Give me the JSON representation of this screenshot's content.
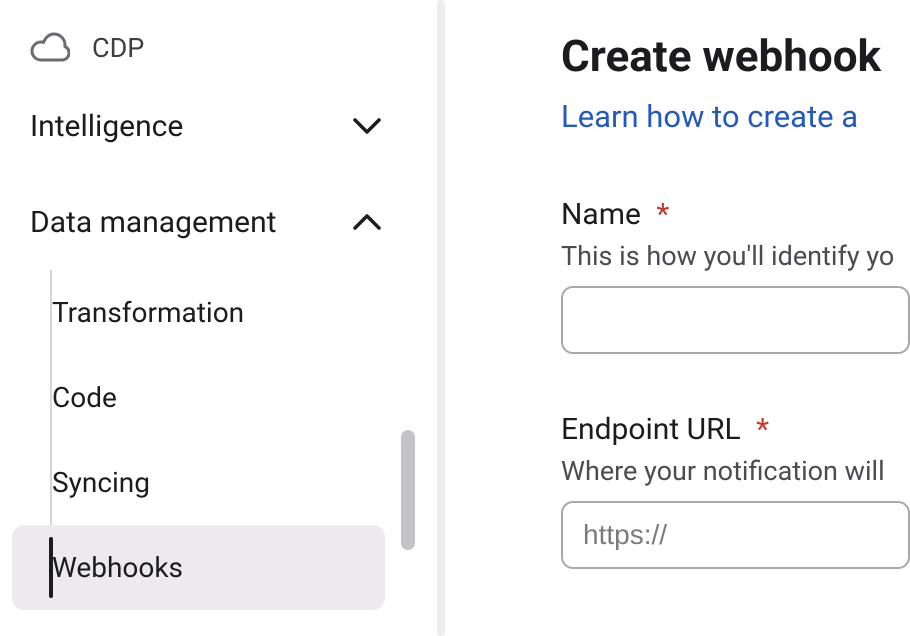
{
  "sidebar": {
    "cdp_label": "CDP",
    "intelligence_label": "Intelligence",
    "data_management_label": "Data management",
    "items": {
      "transformation": "Transformation",
      "code": "Code",
      "syncing": "Syncing",
      "webhooks": "Webhooks"
    }
  },
  "main": {
    "title": "Create webhook",
    "learn_link": "Learn how to create a",
    "name": {
      "label": "Name",
      "required_marker": "*",
      "help": "This is how you'll identify yo",
      "value": ""
    },
    "endpoint": {
      "label": "Endpoint URL",
      "required_marker": "*",
      "help": "Where your notification will ",
      "placeholder": "https://",
      "value": ""
    }
  },
  "colors": {
    "link": "#2259c1",
    "required": "#c0392b",
    "border": "#a7a7ae"
  }
}
